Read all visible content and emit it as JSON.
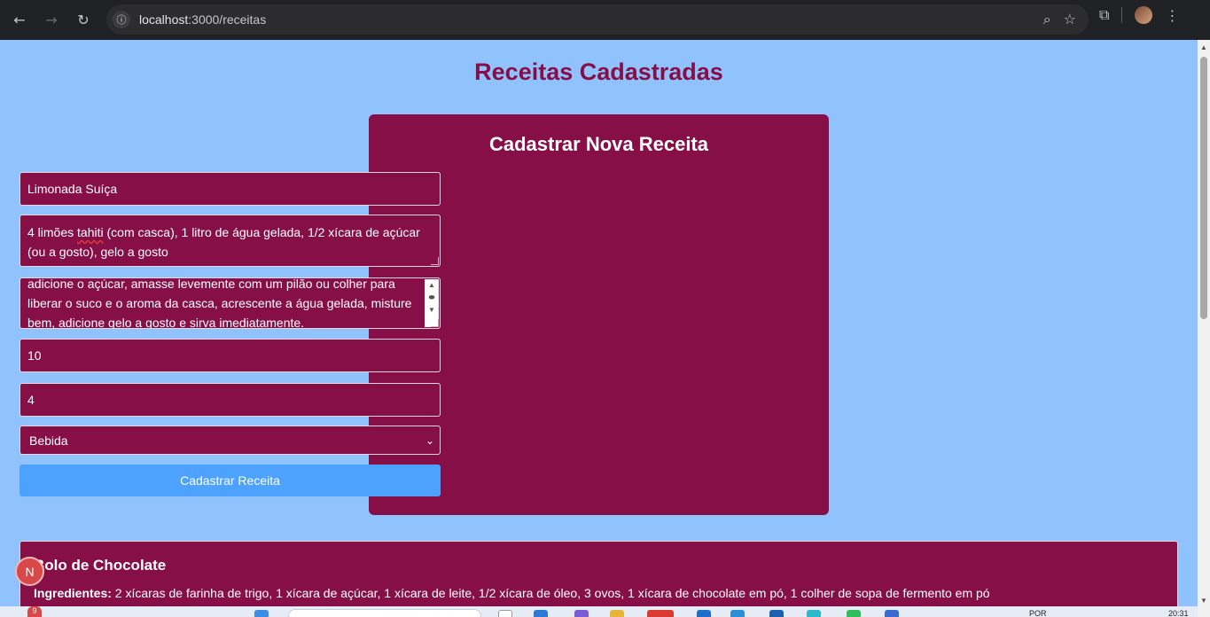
{
  "browser": {
    "url_host": "localhost",
    "url_path": ":3000/receitas",
    "back_icon": "←",
    "forward_icon": "→",
    "reload_icon": "↻",
    "info_icon": "ⓘ",
    "zoom_icon": "⌕",
    "star_icon": "☆",
    "extensions_icon": "⧉",
    "menu_icon": "⋮"
  },
  "page": {
    "title": "Receitas Cadastradas"
  },
  "form": {
    "title": "Cadastrar Nova Receita",
    "name_value": "Limonada Suíça",
    "ingredients_prefix": "4 limões ",
    "ingredients_flagged": "tahiti",
    "ingredients_rest": " (com casca), 1 litro de água gelada, 1/2 xícara de açúcar (ou a gosto), gelo a gosto",
    "preparation_value": "adicione o açúcar, amasse levemente com um pilão ou colher para liberar o suco e o aroma da casca, acrescente a água gelada, misture bem, adicione gelo a gosto e sirva imediatamente.",
    "time_value": "10",
    "servings_value": "4",
    "category_value": "Bebida",
    "submit_label": "Cadastrar Receita"
  },
  "recipes": [
    {
      "title": "Bolo de Chocolate",
      "ingredients_label": "Ingredientes:",
      "ingredients": " 2 xícaras de farinha de trigo, 1 xícara de açúcar, 1 xícara de leite, 1/2 xícara de óleo, 3 ovos, 1 xícara de chocolate em pó, 1 colher de sopa de fermento em pó"
    }
  ],
  "overlay": {
    "next_badge": "N"
  },
  "taskbar": {
    "notification_count": "9",
    "lang": "POR",
    "time": "20:31"
  },
  "colors": {
    "page_bg": "#90c3fe",
    "accent": "#870f48",
    "button": "#4da2fd"
  }
}
